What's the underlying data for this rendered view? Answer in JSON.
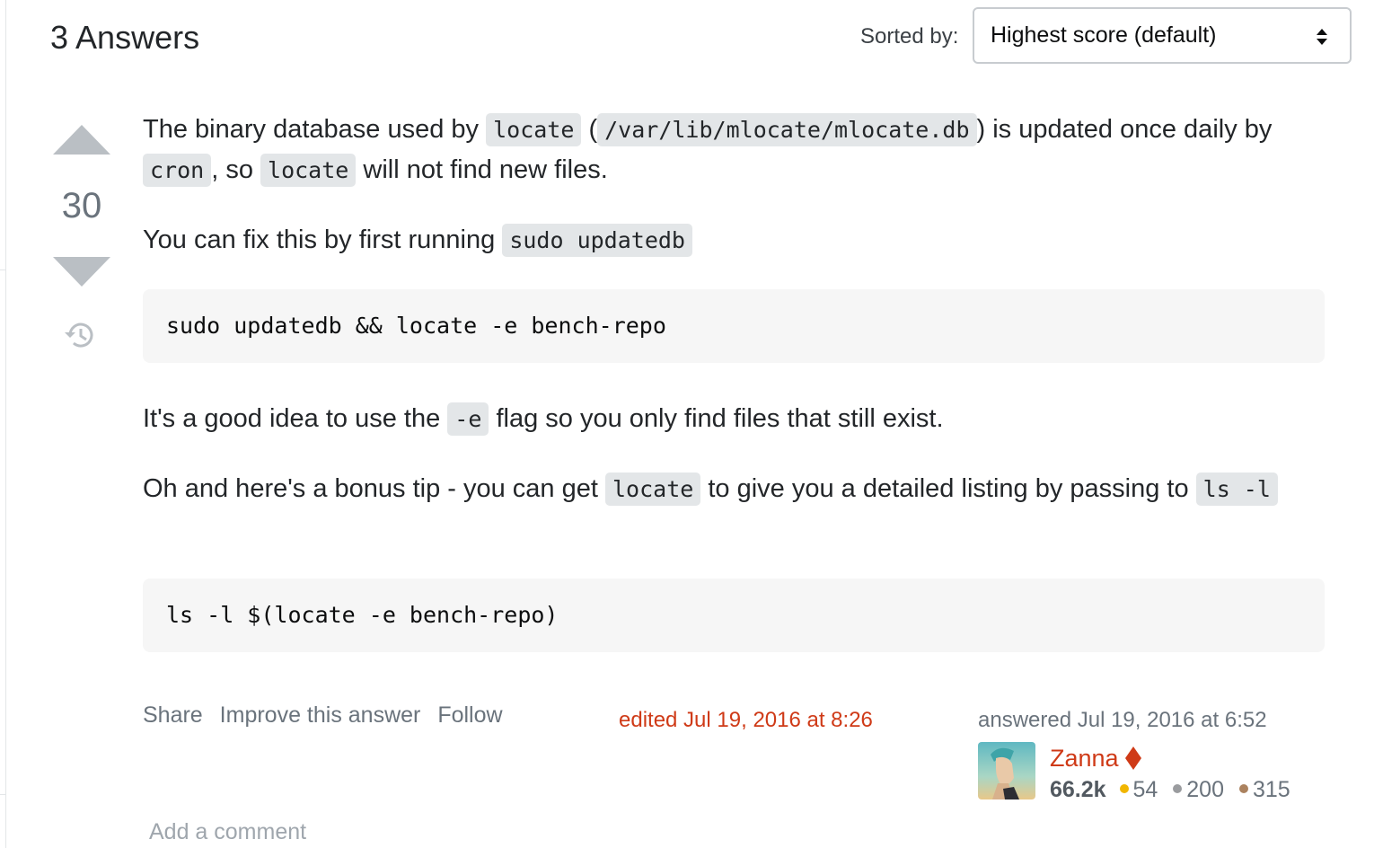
{
  "header": {
    "answers_title": "3 Answers",
    "sorted_label": "Sorted by:",
    "sort_value": "Highest score (default)"
  },
  "vote": {
    "count": "30"
  },
  "post": {
    "p1": {
      "t1": "The binary database used by ",
      "c1": "locate",
      "t2": " (",
      "c2": "/var/lib/mlocate/mlocate.db",
      "t3": ") is updated once daily by ",
      "c3": "cron",
      "t4": ", so ",
      "c4": "locate",
      "t5": " will not find new files."
    },
    "p2": {
      "t1": "You can fix this by first running ",
      "c1": "sudo updatedb"
    },
    "code1": "sudo updatedb && locate -e bench-repo",
    "p3": {
      "t1": "It's a good idea to use the ",
      "c1": "-e",
      "t2": " flag so you only find files that still exist."
    },
    "p4": {
      "t1": "Oh and here's a bonus tip - you can get ",
      "c1": "locate",
      "t2": " to give you a detailed listing by passing to ",
      "c2": "ls -l"
    },
    "code2": "ls -l $(locate -e bench-repo)"
  },
  "actions": {
    "share": "Share",
    "improve": "Improve this answer",
    "follow": "Follow"
  },
  "edited": "edited Jul 19, 2016 at 8:26",
  "user": {
    "answered": "answered Jul 19, 2016 at 6:52",
    "name": "Zanna",
    "reputation": "66.2k",
    "gold": "54",
    "silver": "200",
    "bronze": "315"
  },
  "colors": {
    "accent": "#cf3a17",
    "gold": "#f1b600",
    "silver": "#9a9c9f",
    "bronze": "#ab825f"
  },
  "add_comment": "Add a comment"
}
